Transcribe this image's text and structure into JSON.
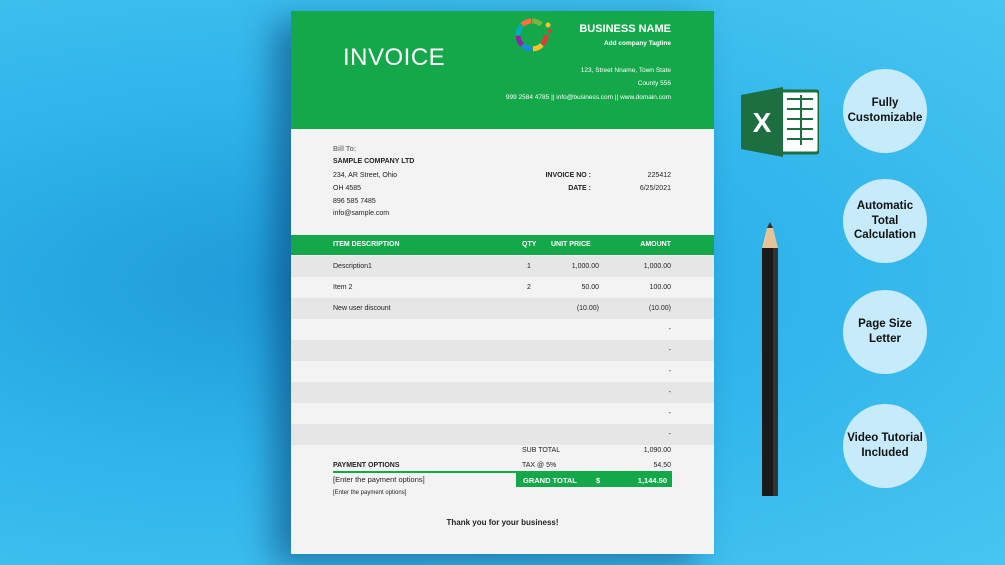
{
  "invoice": {
    "title": "INVOICE",
    "business_name": "BUSINESS NAME",
    "tagline": "Add company  Tagline",
    "address_line1": "123, Street Nname, Town State",
    "address_line2": "County 556",
    "contact": "999 2584 4785  ||  info@business.com || www.domain.com",
    "bill_to_label": "Bill To:",
    "bill_to": {
      "company": "SAMPLE COMPANY LTD",
      "street": "234, AR Street, Ohio",
      "city": "OH 4585",
      "phone": "896 585 7485",
      "email": "info@sample.com"
    },
    "invoice_no_label": "INVOICE NO :",
    "invoice_no": "225412",
    "date_label": "DATE :",
    "date": "6/25/2021",
    "columns": {
      "desc": "ITEM DESCRIPTION",
      "qty": "QTY",
      "price": "UNIT PRICE",
      "amount": "AMOUNT"
    },
    "items": [
      {
        "desc": "Description1",
        "qty": "1",
        "price": "1,000.00",
        "amount": "1,000.00"
      },
      {
        "desc": "Item 2",
        "qty": "2",
        "price": "50.00",
        "amount": "100.00"
      },
      {
        "desc": "New user discount",
        "qty": "",
        "price": "(10.00)",
        "amount": "(10.00)"
      },
      {
        "desc": "",
        "qty": "",
        "price": "",
        "amount": "-"
      },
      {
        "desc": "",
        "qty": "",
        "price": "",
        "amount": "-"
      },
      {
        "desc": "",
        "qty": "",
        "price": "",
        "amount": "-"
      },
      {
        "desc": "",
        "qty": "",
        "price": "",
        "amount": "-"
      },
      {
        "desc": "",
        "qty": "",
        "price": "",
        "amount": "-"
      },
      {
        "desc": "",
        "qty": "",
        "price": "",
        "amount": "-"
      }
    ],
    "subtotal_label": "SUB TOTAL",
    "subtotal": "1,090.00",
    "tax_label": "TAX @ 5%",
    "tax": "54.50",
    "grand_total_label": "GRAND TOTAL",
    "currency": "$",
    "grand_total": "1,144.50",
    "payment_label": "PAYMENT OPTIONS",
    "payment_line1": "[Enter the payment options]",
    "payment_line2": "[Enter the payment options]",
    "thanks": "Thank you for your business!"
  },
  "features": [
    "Fully Customizable",
    "Automatic Total Calculation",
    "Page Size Letter",
    "Video Tutorial Included"
  ],
  "excel_glyph": "X",
  "colors": {
    "accent": "#14a84a",
    "background": "#2fb3ea",
    "bubble": "#c7ebfa"
  }
}
